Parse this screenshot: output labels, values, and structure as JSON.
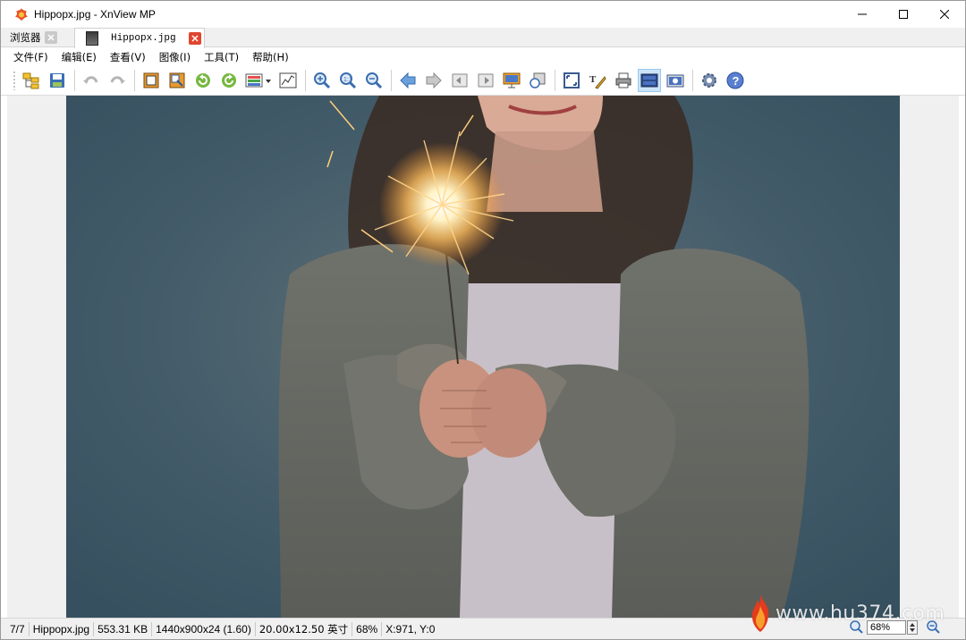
{
  "window": {
    "title": "Hippopx.jpg - XnView MP",
    "app_icon": "xnview-logo-icon"
  },
  "tabs": [
    {
      "label": "浏览器",
      "active": false,
      "close_icon": "close-icon"
    },
    {
      "label": "Hippopx.jpg",
      "active": true,
      "close_icon": "close-icon"
    }
  ],
  "menu": [
    "文件(F)",
    "编辑(E)",
    "查看(V)",
    "图像(I)",
    "工具(T)",
    "帮助(H)"
  ],
  "toolbar": {
    "buttons": [
      "browser-icon",
      "save-icon",
      "undo-icon",
      "redo-icon",
      "crop-icon",
      "resize-icon",
      "rotate-left-icon",
      "rotate-right-icon",
      "adjust-colors-icon",
      "levels-icon",
      "zoom-in-icon",
      "zoom-fit-icon",
      "zoom-out-icon",
      "previous-icon",
      "next-icon",
      "first-icon",
      "last-icon",
      "slideshow-icon",
      "compare-icon",
      "fullscreen-icon",
      "edit-icon",
      "print-icon",
      "filmstrip-icon",
      "capture-icon",
      "settings-icon",
      "help-icon"
    ],
    "active_button": "filmstrip-icon"
  },
  "status": {
    "index": "7/7",
    "filename": "Hippopx.jpg",
    "filesize": "553.31 KB",
    "dimensions": "1440x900x24 (1.60)",
    "print_size": "20.00x12.50 英寸",
    "zoom": "68%",
    "coords": "X:971, Y:0"
  },
  "zoom_control": {
    "value": "68%"
  },
  "watermark": {
    "text": "www.hu374.com"
  },
  "colors": {
    "accent_red": "#e0452f",
    "toolbar_active": "#cce4f7",
    "photo_bg": "#3f5868"
  }
}
